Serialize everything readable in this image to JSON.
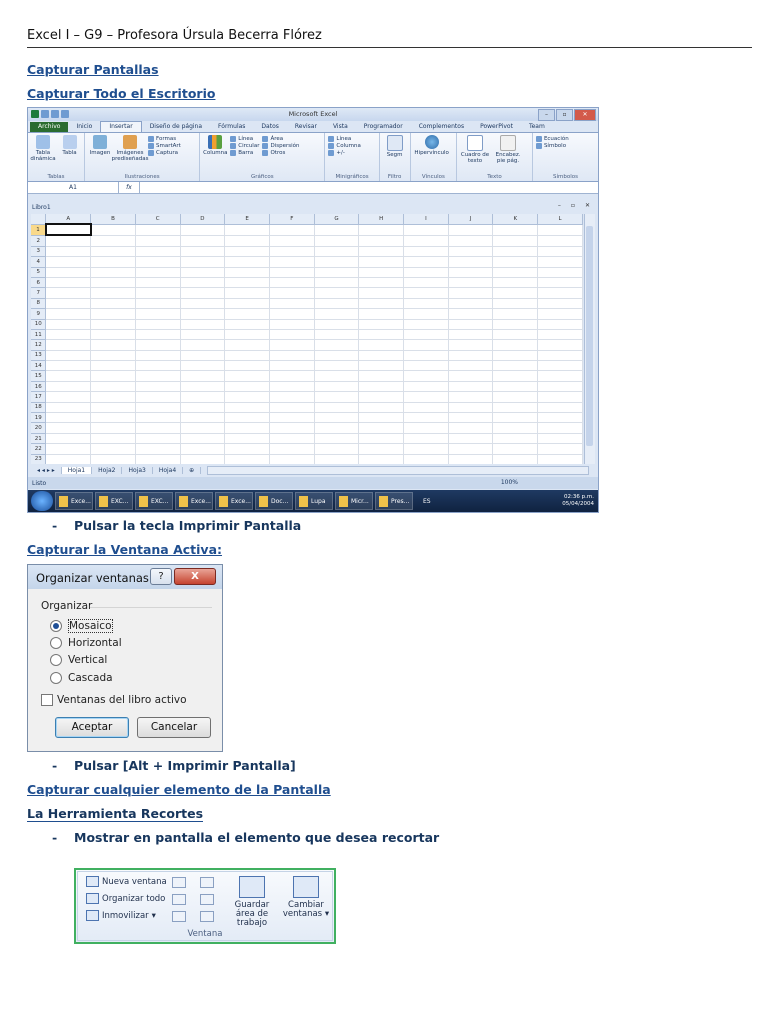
{
  "header": {
    "text": "Excel I – G9 – Profesora Úrsula Becerra Flórez"
  },
  "headings": {
    "h1": "Capturar Pantallas",
    "h2": "Capturar Todo el Escritorio",
    "h3": "Capturar la Ventana Activa:",
    "h4": "Capturar cualquier elemento de la Pantalla",
    "h5_pre": "La Herramienta ",
    "h5_bold": "Recortes"
  },
  "bullets": {
    "b1": "Pulsar la tecla Imprimir Pantalla",
    "b2": "Pulsar [Alt + Imprimir Pantalla]",
    "b3": "Mostrar en pantalla el elemento que desea recortar"
  },
  "bullet_dash": "-",
  "excel": {
    "window_title": "Microsoft Excel",
    "window_controls": [
      "–",
      "▫",
      "✕"
    ],
    "tabs": [
      "Archivo",
      "Inicio",
      "Insertar",
      "Diseño de página",
      "Fórmulas",
      "Datos",
      "Revisar",
      "Vista",
      "Programador",
      "Complementos",
      "PowerPivot",
      "Team"
    ],
    "ribbon_groups": {
      "tablas": {
        "label": "Tablas",
        "buttons": [
          "Tabla dinámica",
          "Tabla"
        ]
      },
      "ilustraciones": {
        "label": "Ilustraciones",
        "buttons": [
          "Imagen",
          "Imágenes prediseñadas"
        ],
        "small": [
          "Formas",
          "SmartArt",
          "Captura"
        ]
      },
      "graficos": {
        "label": "Gráficos",
        "buttons": [
          "Columna"
        ],
        "small": [
          "Línea",
          "Circular",
          "Barra",
          "Área",
          "Dispersión",
          "Otros"
        ]
      },
      "minigraficos": {
        "label": "Minigráficos",
        "small": [
          "Línea",
          "Columna",
          "+/-"
        ]
      },
      "filtro": {
        "label": "Filtro",
        "buttons": [
          "Segm"
        ]
      },
      "vinculos": {
        "label": "Vínculos",
        "buttons": [
          "Hipervínculo"
        ]
      },
      "texto": {
        "label": "Texto",
        "buttons": [
          "Cuadro de texto",
          "Encabez. pie pág."
        ]
      },
      "simbolos": {
        "label": "Símbolos",
        "small": [
          "Ecuación",
          "Símbolo"
        ]
      }
    },
    "name_box": "A1",
    "fx": "fx",
    "workbook_title": "Libro1",
    "columns": [
      "A",
      "B",
      "C",
      "D",
      "E",
      "F",
      "G",
      "H",
      "I",
      "J",
      "K",
      "L"
    ],
    "rows": [
      "1",
      "2",
      "3",
      "4",
      "5",
      "6",
      "7",
      "8",
      "9",
      "10",
      "11",
      "12",
      "13",
      "14",
      "15",
      "16",
      "17",
      "18",
      "19",
      "20",
      "21",
      "22",
      "23"
    ],
    "sheets": [
      "Hoja1",
      "Hoja2",
      "Hoja3",
      "Hoja4"
    ],
    "status": "Listo",
    "zoom": "100%",
    "taskbar": [
      "Exce...",
      "EXC...",
      "EXC...",
      "Exce...",
      "Exce...",
      "Doc...",
      "Lupa",
      "Micr...",
      "Pres..."
    ],
    "lang": "ES",
    "clock_time": "02:36 p.m.",
    "clock_date": "05/04/2004"
  },
  "dialog": {
    "title": "Organizar ventanas",
    "help": "?",
    "close": "X",
    "group": "Organizar",
    "options": [
      "Mosaico",
      "Horizontal",
      "Vertical",
      "Cascada"
    ],
    "selected": "Mosaico",
    "checkbox": "Ventanas del libro activo",
    "accept": "Aceptar",
    "cancel": "Cancelar"
  },
  "window_group": {
    "items": [
      "Nueva ventana",
      "Organizar todo",
      "Inmovilizar"
    ],
    "save_workspace": "Guardar área de trabajo",
    "switch_windows": "Cambiar ventanas",
    "label": "Ventana"
  },
  "colors": {
    "heading": "#17365d",
    "link": "#1f4e8f",
    "green_border": "#40b060"
  }
}
